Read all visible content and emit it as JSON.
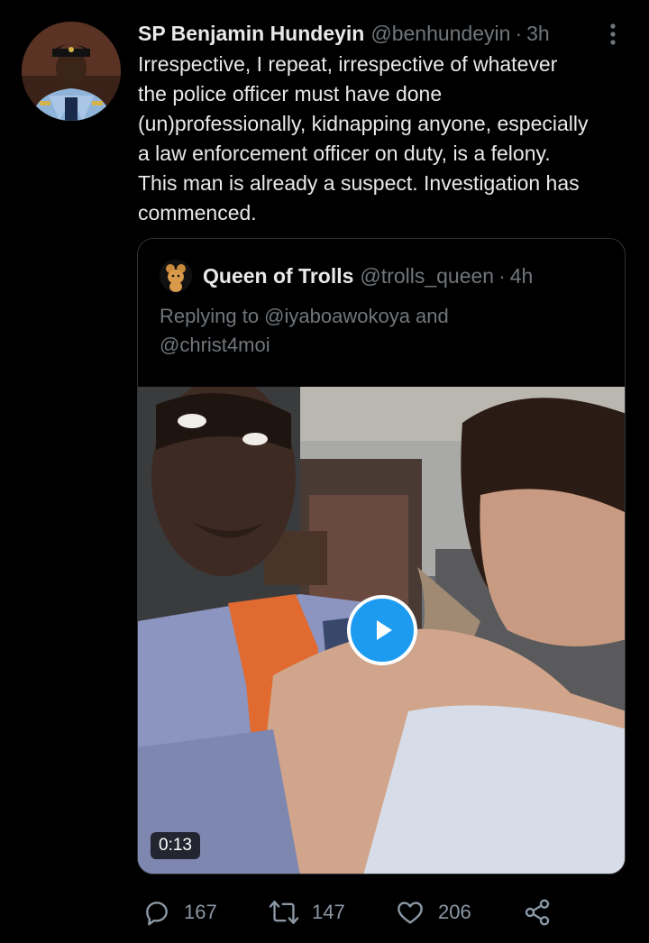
{
  "tweet": {
    "display_name": "SP Benjamin Hundeyin",
    "handle": "@benhundeyin",
    "separator": "·",
    "time": "3h",
    "text_lines": [
      "Irrespective, I repeat, irrespective of whatever",
      "the police officer must have done",
      "(un)professionally, kidnapping anyone, especially",
      "a law enforcement officer on duty, is a felony.",
      "This man is already a suspect. Investigation has",
      "commenced."
    ],
    "more_icon": "more-vertical-icon"
  },
  "quote": {
    "display_name": "Queen of Trolls",
    "handle": "@trolls_queen",
    "separator": "·",
    "time": "4h",
    "reply_lines": [
      "Replying to @iyaboawokoya and",
      "@christ4moi"
    ],
    "video": {
      "duration": "0:13",
      "play_icon": "play-icon"
    }
  },
  "actions": {
    "reply_count": "167",
    "retweet_count": "147",
    "like_count": "206",
    "icons": [
      "reply-icon",
      "retweet-icon",
      "like-icon",
      "share-icon"
    ]
  },
  "colors": {
    "background": "#000000",
    "text_primary": "#e7e9ea",
    "text_secondary": "#71767b",
    "accent": "#1d9bf0",
    "border": "#2f3336"
  }
}
